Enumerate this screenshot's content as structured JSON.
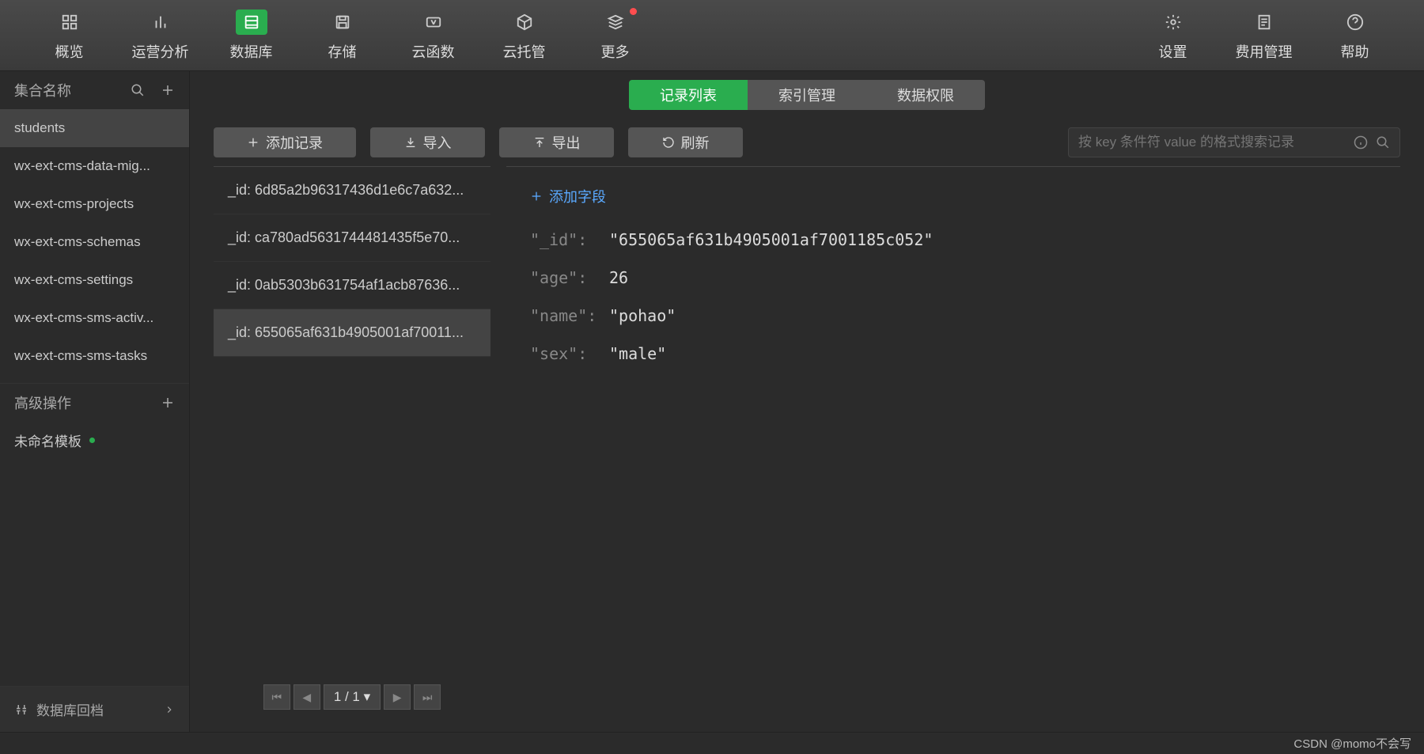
{
  "topnav": {
    "left": [
      {
        "label": "概览",
        "icon": "grid"
      },
      {
        "label": "运营分析",
        "icon": "bars"
      },
      {
        "label": "数据库",
        "icon": "db",
        "active": true
      },
      {
        "label": "存储",
        "icon": "save"
      },
      {
        "label": "云函数",
        "icon": "fx"
      },
      {
        "label": "云托管",
        "icon": "cube"
      },
      {
        "label": "更多",
        "icon": "stack",
        "badge": true
      }
    ],
    "right": [
      {
        "label": "设置",
        "icon": "gear"
      },
      {
        "label": "费用管理",
        "icon": "receipt"
      },
      {
        "label": "帮助",
        "icon": "help"
      }
    ]
  },
  "sidebar": {
    "collections_header": "集合名称",
    "collections": [
      {
        "name": "students",
        "selected": true
      },
      {
        "name": "wx-ext-cms-data-mig..."
      },
      {
        "name": "wx-ext-cms-projects"
      },
      {
        "name": "wx-ext-cms-schemas"
      },
      {
        "name": "wx-ext-cms-settings"
      },
      {
        "name": "wx-ext-cms-sms-activ..."
      },
      {
        "name": "wx-ext-cms-sms-tasks"
      }
    ],
    "advanced_header": "高级操作",
    "template_label": "未命名模板",
    "footer_label": "数据库回档"
  },
  "tabs": [
    {
      "label": "记录列表",
      "active": true
    },
    {
      "label": "索引管理"
    },
    {
      "label": "数据权限"
    }
  ],
  "toolbar": {
    "add_record": "添加记录",
    "import": "导入",
    "export": "导出",
    "refresh": "刷新",
    "search_placeholder": "按 key 条件符 value 的格式搜索记录"
  },
  "records": [
    {
      "label": "_id: 6d85a2b96317436d1e6c7a632..."
    },
    {
      "label": "_id: ca780ad5631744481435f5e70..."
    },
    {
      "label": "_id: 0ab5303b631754af1acb87636..."
    },
    {
      "label": "_id: 655065af631b4905001af70011...",
      "selected": true
    }
  ],
  "pagination": {
    "label": "1 / 1"
  },
  "detail": {
    "add_field": "添加字段",
    "rows": [
      {
        "key": "\"_id\":",
        "val": "\"655065af631b4905001af7001185c052\""
      },
      {
        "key": "\"age\":",
        "val": "26"
      },
      {
        "key": "\"name\":",
        "val": "\"pohao\""
      },
      {
        "key": "\"sex\":",
        "val": "\"male\""
      }
    ]
  },
  "footer": {
    "watermark": "CSDN @momo不会写"
  }
}
